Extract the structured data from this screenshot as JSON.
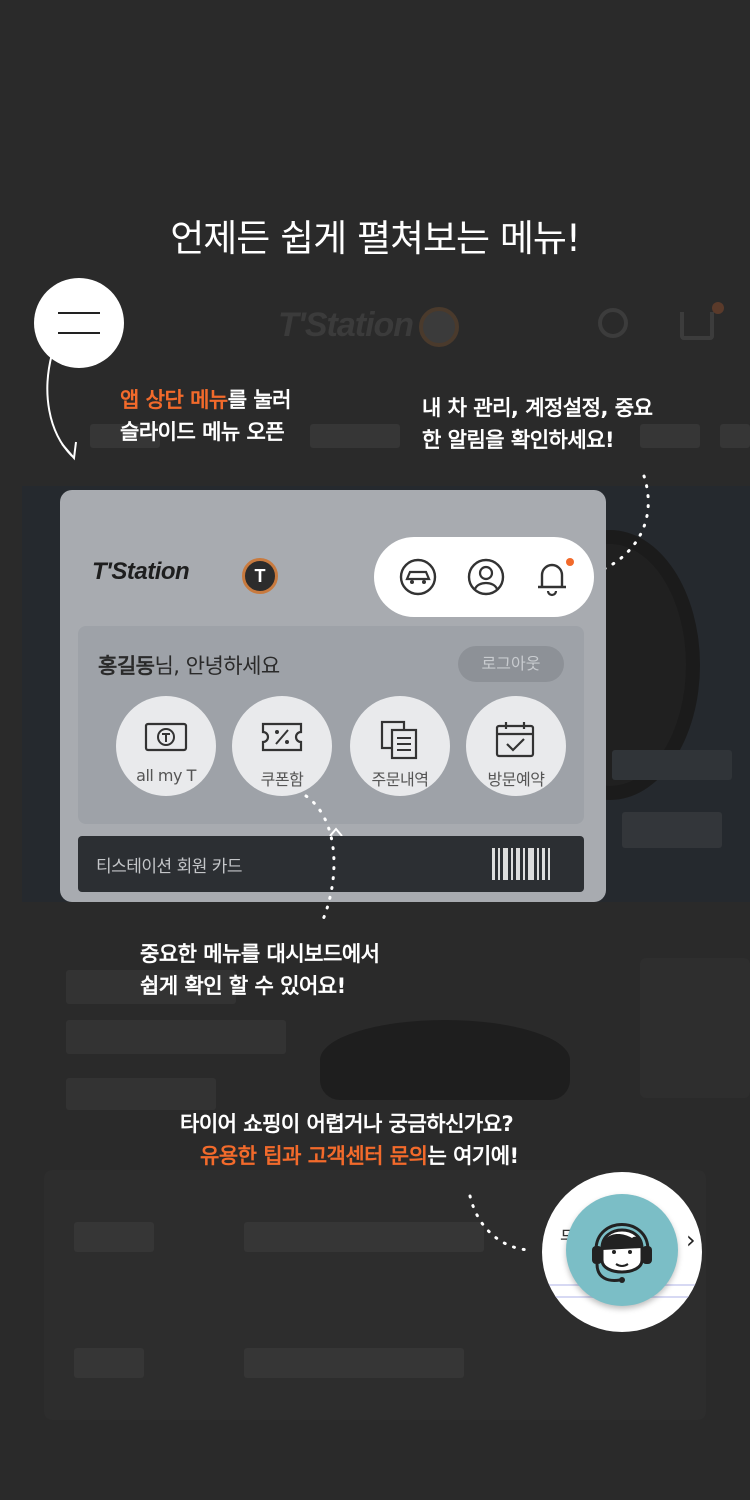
{
  "headline": "언제든 쉽게 펼쳐보는 메뉴!",
  "hamburger_caption": {
    "line1_accent": "앱 상단 메뉴",
    "line1_rest": "를 눌러",
    "line2": "슬라이드 메뉴 오픈"
  },
  "top_icons_caption": {
    "line1": "내 차 관리, 계정설정, 중요",
    "line2": "한 알림을 확인하세요!"
  },
  "menu": {
    "logo_text": "T'Station",
    "logo_badge": "T",
    "greeting_name": "홍길동",
    "greeting_rest": "님, 안녕하세요",
    "logout_label": "로그아웃",
    "quick_items": [
      {
        "label": "all my T",
        "icon": "t-card-icon"
      },
      {
        "label": "쿠폰함",
        "icon": "coupon-icon"
      },
      {
        "label": "주문내역",
        "icon": "order-history-icon"
      },
      {
        "label": "방문예약",
        "icon": "calendar-check-icon"
      }
    ],
    "member_card_label": "티스테이션 회원 카드",
    "top_icons": [
      "my-car-icon",
      "account-icon",
      "bell-icon"
    ]
  },
  "dashboard_caption": {
    "line1": "중요한 메뉴를 대시보드에서",
    "line2": "쉽게 확인 할 수 있어요!"
  },
  "support_caption": {
    "line1": "타이어 쇼핑이 어렵거나 궁금하신가요?",
    "line2_accent": "유용한 팁과 고객센터 문의",
    "line2_rest": "는 여기에!"
  },
  "colors": {
    "accent": "#f26a2b",
    "support_bg": "#7bbec6",
    "card_bg": "#a8abb0"
  }
}
